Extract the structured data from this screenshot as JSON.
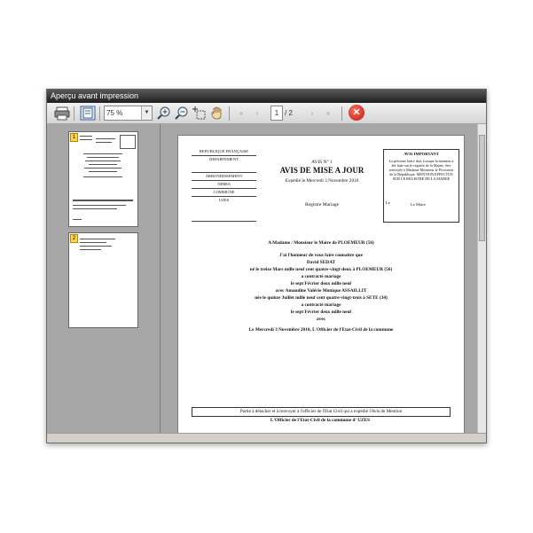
{
  "window": {
    "title": "Aperçu avant impression"
  },
  "toolbar": {
    "zoom_value": "75 %",
    "current_page": "1",
    "page_total": "/ 2",
    "icons": [
      "printer-icon",
      "page-layout-icon",
      "zoom-in-icon",
      "zoom-out-icon",
      "crop-select-icon",
      "hand-pan-icon",
      "first-page-icon",
      "previous-page-icon",
      "next-page-icon",
      "last-page-icon",
      "close-icon"
    ]
  },
  "thumbnails": [
    {
      "number": "1"
    },
    {
      "number": "2"
    }
  ],
  "document": {
    "left_header": {
      "republique": "REPUBLIQUE FRANÇAISE",
      "departement": "DEPARTEMENT",
      "arrondissement": "ARRONDISSEMENT",
      "arrondissement_value": "NIMES",
      "commune": "COMMUNE",
      "commune_value": "UZES"
    },
    "center_header": {
      "avis_no": "AVIS N° 1",
      "title": "AVIS DE MISE A JOUR",
      "expedie": "Expédié le Mercredi 3 Novembre 2010",
      "registre": "Registre   Mariage"
    },
    "important_box": {
      "title": "AVIS IMPORTANT",
      "text": "La présente lettre doit, lorsque la mention a été faite sur le registre de la Mairie, être renvoyée à Madame Monsieur le Procureur de la République. MENTION EFFECTUE SUR LE REGISTRE DE LA MAIRIE",
      "le": "Le",
      "le_maire": "Le Maire"
    },
    "body": [
      "A Madame / Monsieur le Maire de PLOEMEUR (56)",
      "J'ai l'honneur de vous faire connaitre que",
      "David SEDAT",
      "né le treize Mars mille neuf cent quatre-vingt-deux à PLOEMEUR (56)",
      "a contracté mariage",
      "le sept Février deux mille neuf",
      "avec Amandine Valérie Monique ASSAILLIT",
      "née le quinze Juillet mille neuf cent quatre-vingt-trois à SETE (34)",
      "a contracté mariage",
      "le sept Février deux mille neuf",
      "avec",
      "Le Mercredi 3 Novembre 2010, L'Officier de l'Etat-Civil de la commune"
    ],
    "detach_text": "Partie à détacher et à renvoyer à l'officier de l'Etat Civil qui a expédié l'Avis de Mention",
    "officier_text": "L'Officier de l'Etat-Civil de la commune d' UZES"
  }
}
